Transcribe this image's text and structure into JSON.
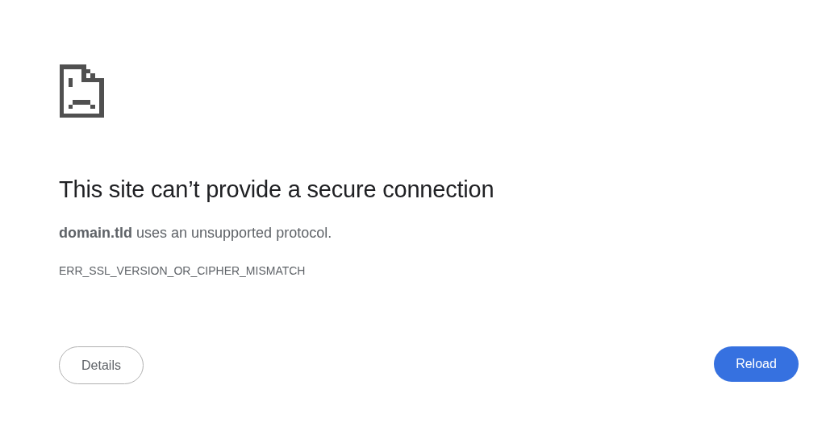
{
  "title": "This site can’t provide a secure connection",
  "message": "**domain.tld** uses an unsupported protocol.",
  "error_code": "ERR_SSL_VERSION_OR_CIPHER_MISMATCH",
  "buttons": [
    {
      "label": "Details",
      "kind": "secondary"
    },
    {
      "label": "Reload",
      "kind": "primary"
    }
  ]
}
